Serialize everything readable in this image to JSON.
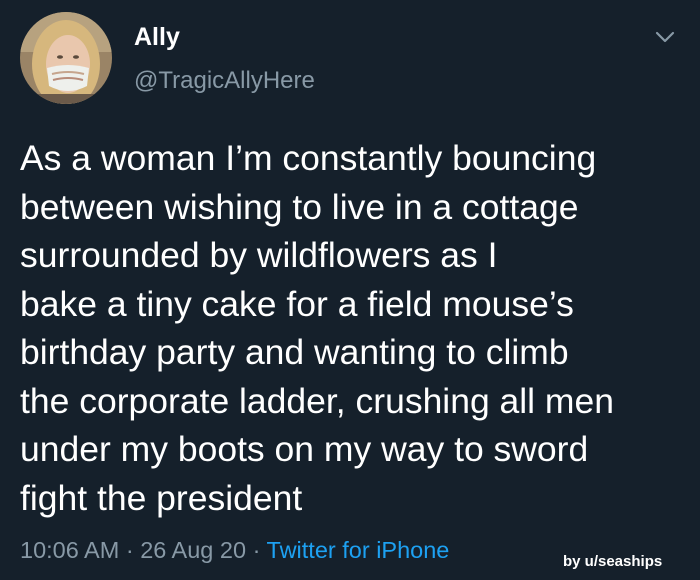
{
  "tweet": {
    "author_name": "Ally",
    "author_handle": "@TragicAllyHere",
    "text": "As a woman I’m constantly bouncing\nbetween wishing to live in a cottage\nsurrounded by wildflowers as I\nbake a tiny cake for a field mouse’s\nbirthday party and wanting to climb\nthe corporate ladder, crushing all men\nunder my boots on my way to sword\nfight the president",
    "time": "10:06 AM",
    "separator": "·",
    "date": "26 Aug 20",
    "source": "Twitter for iPhone"
  },
  "watermark": "by u/seaships",
  "colors": {
    "background": "#15202b",
    "text": "#ffffff",
    "muted": "#8899a6",
    "link": "#1da1f2"
  },
  "icons": {
    "menu": "chevron-down-icon"
  }
}
